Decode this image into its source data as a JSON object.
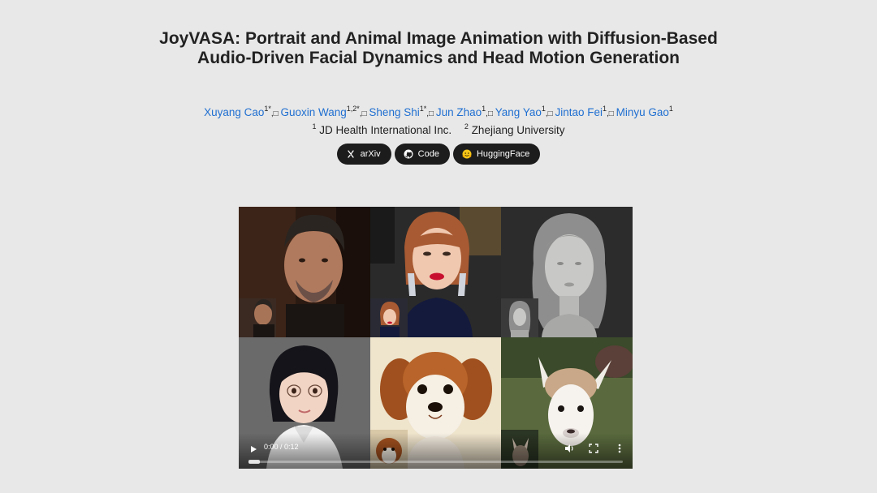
{
  "title": "JoyVASA: Portrait and Animal Image Animation with Diffusion-Based Audio-Driven Facial Dynamics and Head Motion Generation",
  "authors": [
    {
      "name": "Xuyang Cao",
      "sup": "1*"
    },
    {
      "name": "Guoxin Wang",
      "sup": "1,2*"
    },
    {
      "name": "Sheng Shi",
      "sup": "1*"
    },
    {
      "name": "Jun Zhao",
      "sup": "1"
    },
    {
      "name": "Yang Yao",
      "sup": "1"
    },
    {
      "name": "Jintao Fei",
      "sup": "1"
    },
    {
      "name": "Minyu Gao",
      "sup": "1"
    }
  ],
  "author_separator": ",",
  "separator_glyph": " ",
  "affiliations": [
    {
      "num": "1",
      "name": "JD Health International Inc."
    },
    {
      "num": "2",
      "name": "Zhejiang University"
    }
  ],
  "buttons": [
    {
      "label": "arXiv",
      "icon": "arxiv-icon"
    },
    {
      "label": "Code",
      "icon": "github-icon"
    },
    {
      "label": "HuggingFace",
      "icon": "huggingface-icon"
    }
  ],
  "video": {
    "time": "0:00 / 0:12",
    "progress": 0.0,
    "panels": [
      "man-portrait",
      "woman-red-lips",
      "statue",
      "cartoon-girl",
      "poodle-dog",
      "alpaca"
    ]
  },
  "colors": {
    "link": "#1f6fd1",
    "button_bg": "#1c1c1c",
    "page_bg": "#e8e8e8"
  }
}
